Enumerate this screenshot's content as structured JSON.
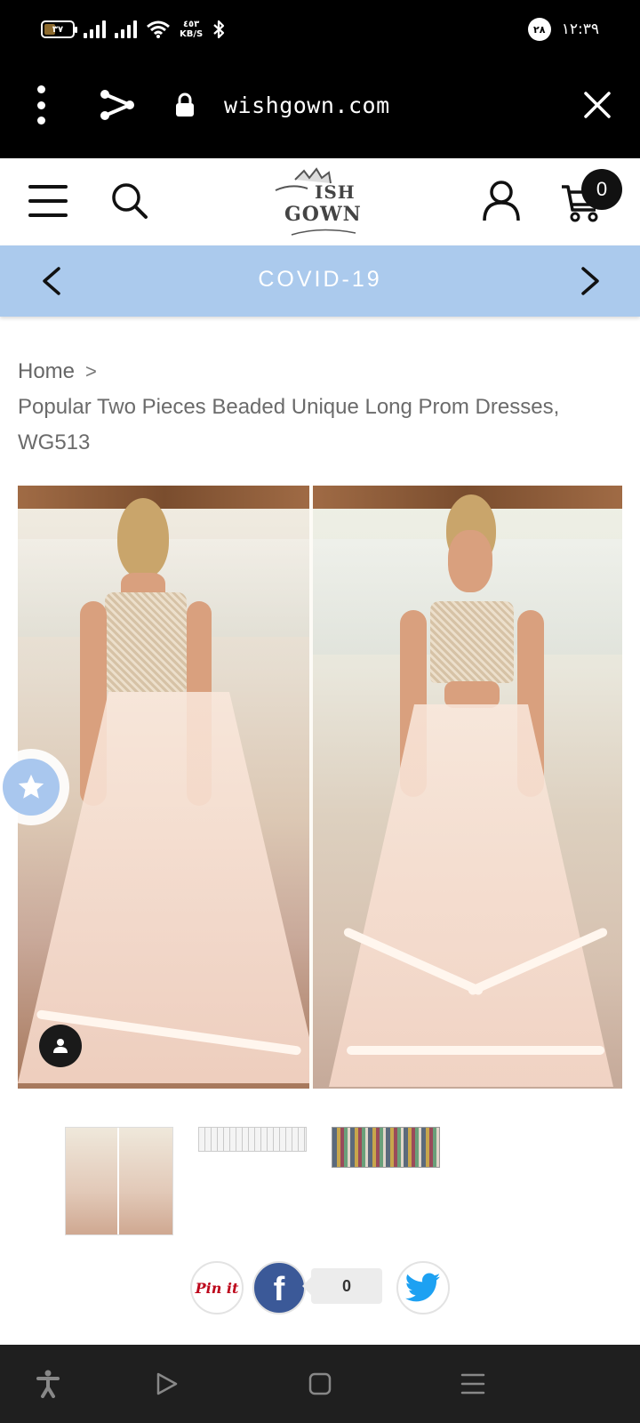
{
  "status_bar": {
    "battery_level": "٣٧",
    "battery_fraction": 0.37,
    "net_speed_value": "٤٥٣",
    "net_speed_unit": "KB/S",
    "notification_count": "٢٨",
    "time": "١٢:٣٩"
  },
  "browser": {
    "url": "wishgown.com",
    "icons": [
      "more-vert-icon",
      "share-icon",
      "lock-icon",
      "close-icon"
    ]
  },
  "header": {
    "logo_line1": "ISH",
    "logo_line2": "GOWN",
    "cart_count": "0",
    "icons": [
      "menu-icon",
      "search-icon",
      "user-icon",
      "cart-icon"
    ]
  },
  "promo": {
    "text": "COVID-19",
    "background": "#abcaed"
  },
  "breadcrumb": {
    "home": "Home",
    "separator": ">",
    "title": "Popular Two Pieces Beaded Unique Long Prom Dresses, WG513"
  },
  "share": {
    "pinterest_label": "Pin it",
    "facebook_label": "f",
    "facebook_count": "0",
    "colors": {
      "pinterest": "#bd081c",
      "facebook": "#3b5998",
      "twitter": "#1da1f2"
    }
  },
  "nav": {
    "icons": [
      "accessibility-icon",
      "back-triangle-icon",
      "home-square-icon",
      "recents-menu-icon"
    ]
  }
}
